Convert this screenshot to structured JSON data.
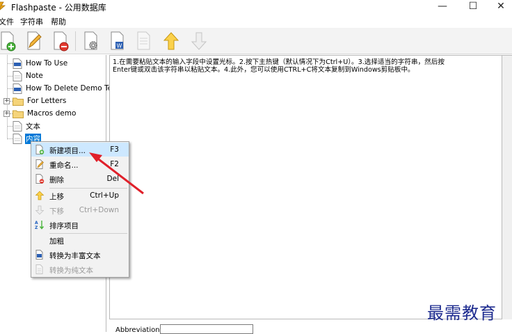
{
  "window": {
    "title": "Flashpaste - 公用数据库",
    "min_glyph": "—",
    "max_glyph": "☐",
    "close_glyph": "✕"
  },
  "menu": [
    "文件",
    "字符串",
    "帮助"
  ],
  "toolbar": {
    "buttons": [
      "new-item-icon",
      "edit-icon",
      "delete-icon",
      "settings-icon",
      "word-icon",
      "document-disabled-icon",
      "move-up-icon",
      "move-down-disabled-icon"
    ]
  },
  "tree": {
    "items": [
      {
        "label": "How To Use",
        "icon": "rtf-doc-icon",
        "expandable": false
      },
      {
        "label": "Note",
        "icon": "doc-icon",
        "expandable": false
      },
      {
        "label": "How To Delete Demo Text",
        "icon": "rtf-doc-icon",
        "expandable": false
      },
      {
        "label": "For Letters",
        "icon": "folder-icon",
        "expandable": true
      },
      {
        "label": "Macros demo",
        "icon": "folder-icon",
        "expandable": true
      },
      {
        "label": "文本",
        "icon": "doc-icon",
        "expandable": false
      },
      {
        "label": "内容",
        "icon": "doc-icon",
        "expandable": false,
        "selected": true
      }
    ]
  },
  "content": {
    "line1": "1.在需要粘贴文本的输入字段中设置光标。2.按下主热键（默认情况下为Ctrl+U）。3.选择适当的字符串，然后按",
    "line2": "Enter键或双击该字符串以粘贴文本。4.此外，您可以使用CTRL+C将文本复制到Windows剪贴板中。"
  },
  "abbreviation": {
    "label": "Abbreviation:",
    "value": ""
  },
  "context_menu": {
    "items": [
      {
        "label": "新建项目...",
        "shortcut": "F3",
        "icon": "new-item-icon",
        "disabled": false,
        "hover": true
      },
      {
        "label": "重命名...",
        "shortcut": "F2",
        "icon": "rename-icon",
        "disabled": false
      },
      {
        "label": "删除",
        "shortcut": "Del",
        "icon": "delete-icon",
        "disabled": false
      },
      {
        "label": "上移",
        "shortcut": "Ctrl+Up",
        "icon": "move-up-icon",
        "disabled": false
      },
      {
        "label": "下移",
        "shortcut": "Ctrl+Down",
        "icon": "move-down-icon",
        "disabled": true
      },
      {
        "label": "排序项目",
        "shortcut": "",
        "icon": "sort-icon",
        "disabled": false
      },
      {
        "label": "加粗",
        "shortcut": "",
        "icon": "",
        "disabled": false
      },
      {
        "label": "转换为丰富文本",
        "shortcut": "",
        "icon": "rich-text-icon",
        "disabled": false
      },
      {
        "label": "转换为纯文本",
        "shortcut": "",
        "icon": "plain-text-icon",
        "disabled": true
      }
    ]
  },
  "watermark": "最需教育",
  "colors": {
    "selection": "#0078d7",
    "arrow": "#e0202a",
    "menu_hover": "#cde8ff",
    "watermark": "#1d2b8f"
  }
}
